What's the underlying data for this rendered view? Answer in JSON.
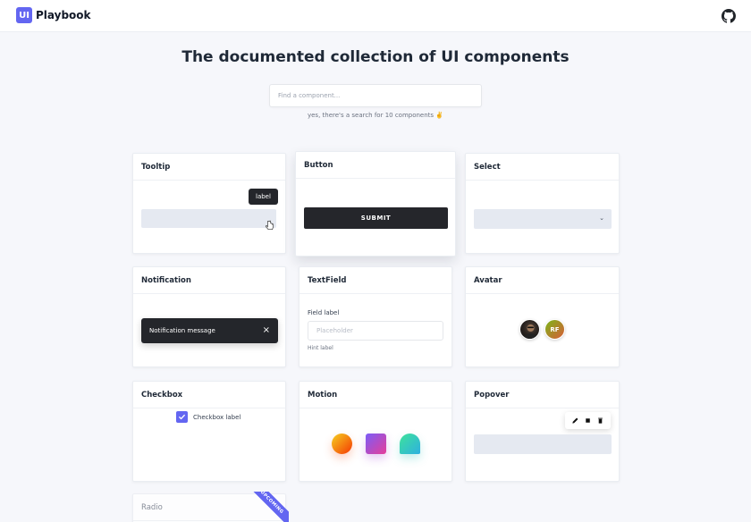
{
  "brand": {
    "mark": "UI",
    "name": "Playbook"
  },
  "header": {
    "github_icon": "github-icon"
  },
  "hero": {
    "title": "The documented collection of UI components",
    "search_placeholder": "Find a component...",
    "search_hint": "yes, there's a search for 10 components ✌️"
  },
  "cards": {
    "tooltip": {
      "title": "Tooltip",
      "label": "label"
    },
    "button": {
      "title": "Button",
      "submit": "SUBMIT"
    },
    "select": {
      "title": "Select",
      "chevron": "⌄"
    },
    "notification": {
      "title": "Notification",
      "message": "Notification message",
      "close": "×"
    },
    "textfield": {
      "title": "TextField",
      "field_label": "Field label",
      "placeholder": "Placeholder",
      "hint": "Hint label"
    },
    "avatar": {
      "title": "Avatar",
      "initials": "RF"
    },
    "checkbox": {
      "title": "Checkbox",
      "label": "Checkbox label",
      "checked": true
    },
    "motion": {
      "title": "Motion"
    },
    "popover": {
      "title": "Popover",
      "actions": [
        "pencil-icon",
        "stop-icon",
        "trash-icon"
      ]
    },
    "radio": {
      "title": "Radio",
      "badge": "UPCOMING"
    }
  },
  "colors": {
    "accent": "#6366f1",
    "dark": "#25262b",
    "field": "#e5e9f1"
  }
}
